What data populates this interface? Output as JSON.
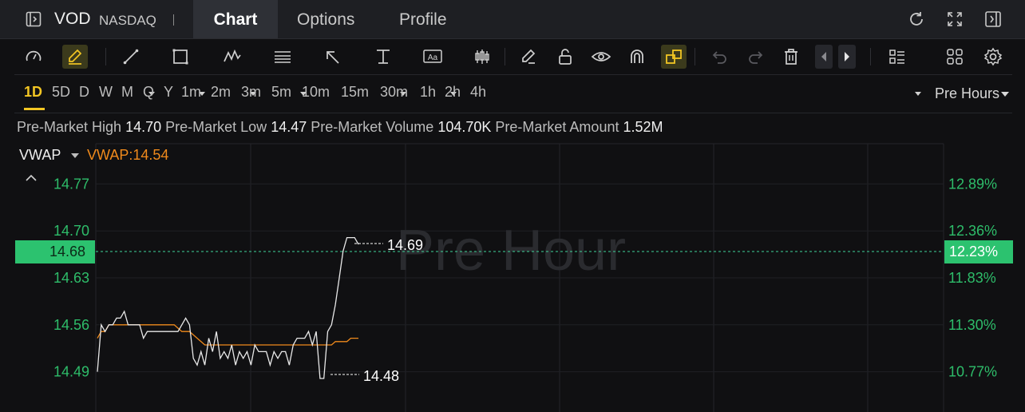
{
  "header": {
    "symbol": "VOD",
    "exchange": "NASDAQ",
    "tabs": [
      {
        "label": "Chart",
        "active": true
      },
      {
        "label": "Options",
        "active": false
      },
      {
        "label": "Profile",
        "active": false
      }
    ],
    "icons": [
      "sidebar-expand-icon",
      "refresh-icon",
      "fullscreen-icon",
      "collapse-panel-icon"
    ]
  },
  "toolbar": {
    "icons": [
      "speedometer-icon",
      "draw-pen-icon",
      "trend-line-icon",
      "rectangle-icon",
      "pattern-icon",
      "fibonacci-icon",
      "arrow-icon",
      "price-range-icon",
      "text-icon",
      "candles-icon",
      "eraser-icon",
      "unlock-icon",
      "eye-icon",
      "magnet-icon",
      "link-icon",
      "undo-icon",
      "redo-icon",
      "trash-icon",
      "prev-icon",
      "next-icon",
      "layout-icon",
      "grid-icon",
      "settings-icon"
    ]
  },
  "timeframes": [
    "1D",
    "5D",
    "D",
    "W",
    "M",
    "Q",
    "Y",
    "1m",
    "2m",
    "3m",
    "5m",
    "10m",
    "15m",
    "30m",
    "1h",
    "2h",
    "4h"
  ],
  "active_timeframe": "1D",
  "session": "Pre Hours",
  "stats": [
    {
      "label": "Pre-Market High",
      "value": "14.70"
    },
    {
      "label": "Pre-Market Low",
      "value": "14.47"
    },
    {
      "label": "Pre-Market Volume",
      "value": "104.70K"
    },
    {
      "label": "Pre-Market Amount",
      "value": "1.52M"
    }
  ],
  "indicator": {
    "name": "VWAP",
    "value_label": "VWAP:14.54"
  },
  "watermark": "Pre Hour",
  "colors": {
    "up": "#2cc26f",
    "vwap": "#f08a1c",
    "price": "#e8e8e8",
    "accent": "#f3c623"
  },
  "chart_data": {
    "type": "line",
    "y_ticks_left": [
      "14.77",
      "14.70",
      "14.63",
      "14.56",
      "14.49"
    ],
    "y_ticks_right": [
      "12.89%",
      "12.36%",
      "11.83%",
      "11.30%",
      "10.77%"
    ],
    "ylim": [
      14.43,
      14.83
    ],
    "last_price": "14.68",
    "last_change": "12.23%",
    "high_label": "14.69",
    "low_label": "14.48",
    "series": [
      {
        "name": "",
        "values": [
          14.49,
          14.56,
          14.55,
          14.56,
          14.56,
          14.57,
          14.57,
          14.58,
          14.56,
          14.56,
          14.56,
          14.56,
          14.54,
          14.55,
          14.55,
          14.55,
          14.55,
          14.55,
          14.55,
          14.55,
          14.55,
          14.55,
          14.56,
          14.57,
          14.56,
          14.51,
          14.5,
          14.52,
          14.5,
          14.54,
          14.52,
          14.55,
          14.51,
          14.52,
          14.51,
          14.53,
          14.5,
          14.52,
          14.51,
          14.52,
          14.5,
          14.53,
          14.52,
          14.52,
          14.52,
          14.5,
          14.52,
          14.51,
          14.52,
          14.52,
          14.5,
          14.53,
          14.54,
          14.54,
          14.54,
          14.55,
          14.53,
          14.55,
          14.48,
          14.48,
          14.55,
          14.56,
          14.59,
          14.63,
          14.67,
          14.69,
          14.69,
          14.69,
          14.68
        ]
      },
      {
        "name": "VWAP",
        "values": [
          14.54,
          14.55,
          14.55,
          14.56,
          14.56,
          14.56,
          14.56,
          14.56,
          14.56,
          14.56,
          14.56,
          14.56,
          14.56,
          14.56,
          14.56,
          14.56,
          14.56,
          14.56,
          14.56,
          14.56,
          14.56,
          14.555,
          14.55,
          14.55,
          14.55,
          14.545,
          14.54,
          14.535,
          14.53,
          14.53,
          14.53,
          14.53,
          14.53,
          14.53,
          14.53,
          14.53,
          14.53,
          14.53,
          14.53,
          14.53,
          14.53,
          14.53,
          14.53,
          14.53,
          14.53,
          14.53,
          14.53,
          14.53,
          14.53,
          14.53,
          14.53,
          14.53,
          14.53,
          14.53,
          14.53,
          14.53,
          14.53,
          14.53,
          14.53,
          14.53,
          14.53,
          14.53,
          14.535,
          14.535,
          14.535,
          14.535,
          14.54,
          14.54,
          14.54
        ]
      }
    ]
  }
}
